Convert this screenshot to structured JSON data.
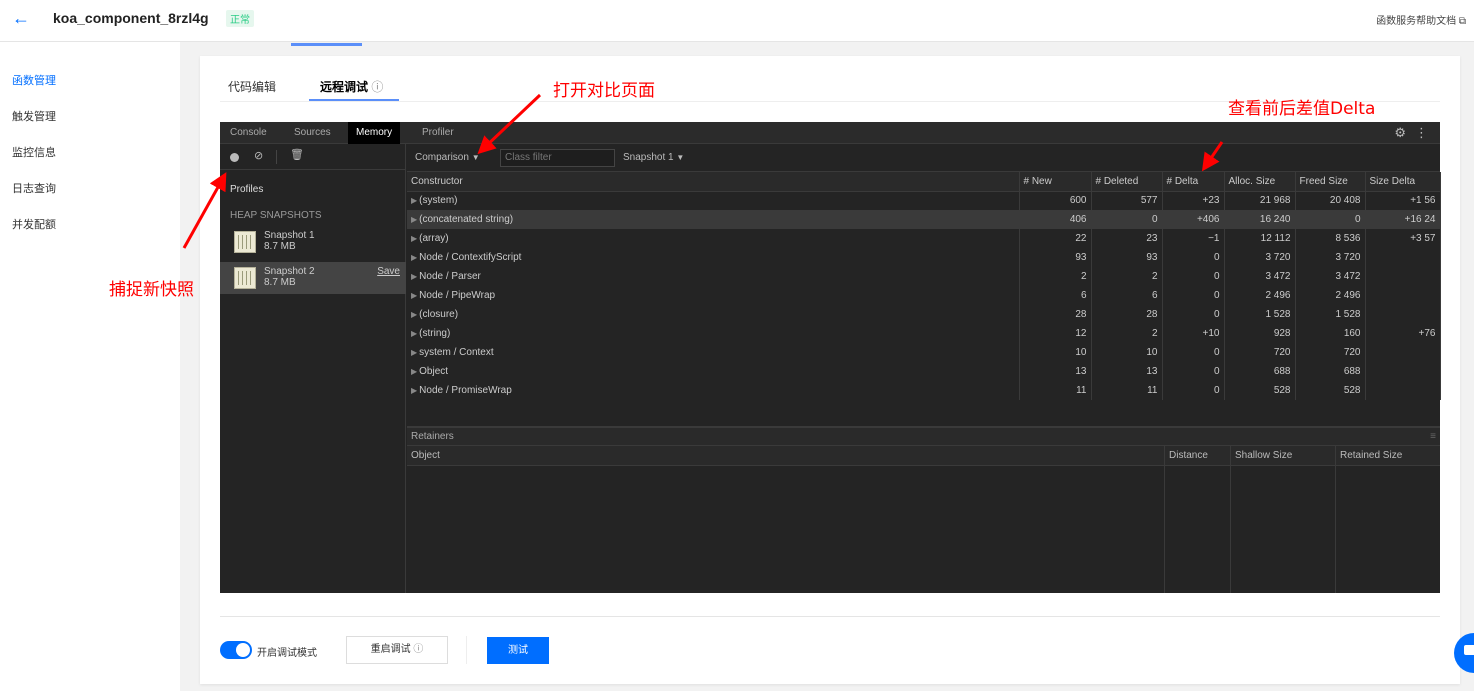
{
  "header": {
    "back_icon": "arrow-left-icon",
    "function_name": "koa_component_8rzl4g",
    "status": "正常",
    "help_link": "函数服务帮助文档",
    "external_icon": "external-link-icon"
  },
  "sidebar": {
    "items": [
      {
        "label": "函数管理",
        "active": true
      },
      {
        "label": "触发管理",
        "active": false
      },
      {
        "label": "监控信息",
        "active": false
      },
      {
        "label": "日志查询",
        "active": false
      },
      {
        "label": "并发配额",
        "active": false
      }
    ]
  },
  "card_tabs": [
    {
      "label": "代码编辑",
      "active": false
    },
    {
      "label": "远程调试",
      "active": true,
      "info_icon": "info-icon"
    }
  ],
  "devtools": {
    "tabs": [
      {
        "label": "Console",
        "active": false
      },
      {
        "label": "Sources",
        "active": false
      },
      {
        "label": "Memory",
        "active": true
      },
      {
        "label": "Profiler",
        "active": false
      }
    ],
    "left": {
      "profiles_label": "Profiles",
      "section_label": "HEAP SNAPSHOTS",
      "snapshots": [
        {
          "name": "Snapshot 1",
          "size": "8.7 MB",
          "selected": false
        },
        {
          "name": "Snapshot 2",
          "size": "8.7 MB",
          "selected": true,
          "action": "Save"
        }
      ]
    },
    "toolbar": {
      "view": "Comparison",
      "class_filter_placeholder": "Class filter",
      "base_snapshot": "Snapshot 1"
    },
    "table": {
      "columns": [
        "Constructor",
        "# New",
        "# Deleted",
        "# Delta",
        "Alloc. Size",
        "Freed Size",
        "Size Delta"
      ],
      "rows": [
        {
          "constructor": "(system)",
          "new": "600",
          "deleted": "577",
          "delta": "+23",
          "alloc": "21 968",
          "freed": "20 408",
          "size_delta": "+1 56"
        },
        {
          "constructor": "(concatenated string)",
          "new": "406",
          "deleted": "0",
          "delta": "+406",
          "alloc": "16 240",
          "freed": "0",
          "size_delta": "+16 24"
        },
        {
          "constructor": "(array)",
          "new": "22",
          "deleted": "23",
          "delta": "−1",
          "alloc": "12 112",
          "freed": "8 536",
          "size_delta": "+3 57"
        },
        {
          "constructor": "Node / ContextifyScript",
          "new": "93",
          "deleted": "93",
          "delta": "0",
          "alloc": "3 720",
          "freed": "3 720",
          "size_delta": ""
        },
        {
          "constructor": "Node / Parser",
          "new": "2",
          "deleted": "2",
          "delta": "0",
          "alloc": "3 472",
          "freed": "3 472",
          "size_delta": ""
        },
        {
          "constructor": "Node / PipeWrap",
          "new": "6",
          "deleted": "6",
          "delta": "0",
          "alloc": "2 496",
          "freed": "2 496",
          "size_delta": ""
        },
        {
          "constructor": "(closure)",
          "new": "28",
          "deleted": "28",
          "delta": "0",
          "alloc": "1 528",
          "freed": "1 528",
          "size_delta": ""
        },
        {
          "constructor": "(string)",
          "new": "12",
          "deleted": "2",
          "delta": "+10",
          "alloc": "928",
          "freed": "160",
          "size_delta": "+76"
        },
        {
          "constructor": "system / Context",
          "new": "10",
          "deleted": "10",
          "delta": "0",
          "alloc": "720",
          "freed": "720",
          "size_delta": ""
        },
        {
          "constructor": "Object",
          "new": "13",
          "deleted": "13",
          "delta": "0",
          "alloc": "688",
          "freed": "688",
          "size_delta": ""
        },
        {
          "constructor": "Node / PromiseWrap",
          "new": "11",
          "deleted": "11",
          "delta": "0",
          "alloc": "528",
          "freed": "528",
          "size_delta": ""
        }
      ]
    },
    "retainers": {
      "title": "Retainers",
      "columns": [
        "Object",
        "Distance",
        "Shallow Size",
        "Retained Size"
      ]
    }
  },
  "annotations": {
    "open_compare": "打开对比页面",
    "view_delta": "查看前后差值Delta",
    "capture_snapshot": "捕捉新快照"
  },
  "footer": {
    "debug_mode_label": "开启调试模式",
    "debug_mode_on": true,
    "restart_button": "重启调试",
    "test_button": "测试"
  },
  "colors": {
    "primary": "#006eff",
    "status_green": "#29cc85",
    "annotation_red": "#ff0000"
  }
}
